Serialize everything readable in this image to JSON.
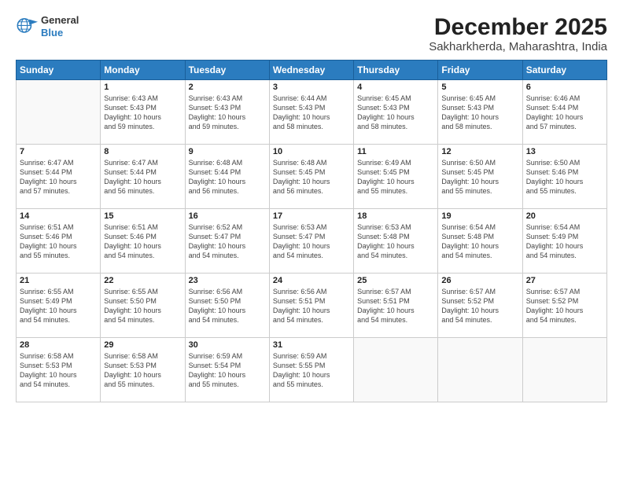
{
  "header": {
    "logo_general": "General",
    "logo_blue": "Blue",
    "month": "December 2025",
    "location": "Sakharkherda, Maharashtra, India"
  },
  "weekdays": [
    "Sunday",
    "Monday",
    "Tuesday",
    "Wednesday",
    "Thursday",
    "Friday",
    "Saturday"
  ],
  "weeks": [
    [
      {
        "day": "",
        "info": ""
      },
      {
        "day": "1",
        "info": "Sunrise: 6:43 AM\nSunset: 5:43 PM\nDaylight: 10 hours\nand 59 minutes."
      },
      {
        "day": "2",
        "info": "Sunrise: 6:43 AM\nSunset: 5:43 PM\nDaylight: 10 hours\nand 59 minutes."
      },
      {
        "day": "3",
        "info": "Sunrise: 6:44 AM\nSunset: 5:43 PM\nDaylight: 10 hours\nand 58 minutes."
      },
      {
        "day": "4",
        "info": "Sunrise: 6:45 AM\nSunset: 5:43 PM\nDaylight: 10 hours\nand 58 minutes."
      },
      {
        "day": "5",
        "info": "Sunrise: 6:45 AM\nSunset: 5:43 PM\nDaylight: 10 hours\nand 58 minutes."
      },
      {
        "day": "6",
        "info": "Sunrise: 6:46 AM\nSunset: 5:44 PM\nDaylight: 10 hours\nand 57 minutes."
      }
    ],
    [
      {
        "day": "7",
        "info": "Sunrise: 6:47 AM\nSunset: 5:44 PM\nDaylight: 10 hours\nand 57 minutes."
      },
      {
        "day": "8",
        "info": "Sunrise: 6:47 AM\nSunset: 5:44 PM\nDaylight: 10 hours\nand 56 minutes."
      },
      {
        "day": "9",
        "info": "Sunrise: 6:48 AM\nSunset: 5:44 PM\nDaylight: 10 hours\nand 56 minutes."
      },
      {
        "day": "10",
        "info": "Sunrise: 6:48 AM\nSunset: 5:45 PM\nDaylight: 10 hours\nand 56 minutes."
      },
      {
        "day": "11",
        "info": "Sunrise: 6:49 AM\nSunset: 5:45 PM\nDaylight: 10 hours\nand 55 minutes."
      },
      {
        "day": "12",
        "info": "Sunrise: 6:50 AM\nSunset: 5:45 PM\nDaylight: 10 hours\nand 55 minutes."
      },
      {
        "day": "13",
        "info": "Sunrise: 6:50 AM\nSunset: 5:46 PM\nDaylight: 10 hours\nand 55 minutes."
      }
    ],
    [
      {
        "day": "14",
        "info": "Sunrise: 6:51 AM\nSunset: 5:46 PM\nDaylight: 10 hours\nand 55 minutes."
      },
      {
        "day": "15",
        "info": "Sunrise: 6:51 AM\nSunset: 5:46 PM\nDaylight: 10 hours\nand 54 minutes."
      },
      {
        "day": "16",
        "info": "Sunrise: 6:52 AM\nSunset: 5:47 PM\nDaylight: 10 hours\nand 54 minutes."
      },
      {
        "day": "17",
        "info": "Sunrise: 6:53 AM\nSunset: 5:47 PM\nDaylight: 10 hours\nand 54 minutes."
      },
      {
        "day": "18",
        "info": "Sunrise: 6:53 AM\nSunset: 5:48 PM\nDaylight: 10 hours\nand 54 minutes."
      },
      {
        "day": "19",
        "info": "Sunrise: 6:54 AM\nSunset: 5:48 PM\nDaylight: 10 hours\nand 54 minutes."
      },
      {
        "day": "20",
        "info": "Sunrise: 6:54 AM\nSunset: 5:49 PM\nDaylight: 10 hours\nand 54 minutes."
      }
    ],
    [
      {
        "day": "21",
        "info": "Sunrise: 6:55 AM\nSunset: 5:49 PM\nDaylight: 10 hours\nand 54 minutes."
      },
      {
        "day": "22",
        "info": "Sunrise: 6:55 AM\nSunset: 5:50 PM\nDaylight: 10 hours\nand 54 minutes."
      },
      {
        "day": "23",
        "info": "Sunrise: 6:56 AM\nSunset: 5:50 PM\nDaylight: 10 hours\nand 54 minutes."
      },
      {
        "day": "24",
        "info": "Sunrise: 6:56 AM\nSunset: 5:51 PM\nDaylight: 10 hours\nand 54 minutes."
      },
      {
        "day": "25",
        "info": "Sunrise: 6:57 AM\nSunset: 5:51 PM\nDaylight: 10 hours\nand 54 minutes."
      },
      {
        "day": "26",
        "info": "Sunrise: 6:57 AM\nSunset: 5:52 PM\nDaylight: 10 hours\nand 54 minutes."
      },
      {
        "day": "27",
        "info": "Sunrise: 6:57 AM\nSunset: 5:52 PM\nDaylight: 10 hours\nand 54 minutes."
      }
    ],
    [
      {
        "day": "28",
        "info": "Sunrise: 6:58 AM\nSunset: 5:53 PM\nDaylight: 10 hours\nand 54 minutes."
      },
      {
        "day": "29",
        "info": "Sunrise: 6:58 AM\nSunset: 5:53 PM\nDaylight: 10 hours\nand 55 minutes."
      },
      {
        "day": "30",
        "info": "Sunrise: 6:59 AM\nSunset: 5:54 PM\nDaylight: 10 hours\nand 55 minutes."
      },
      {
        "day": "31",
        "info": "Sunrise: 6:59 AM\nSunset: 5:55 PM\nDaylight: 10 hours\nand 55 minutes."
      },
      {
        "day": "",
        "info": ""
      },
      {
        "day": "",
        "info": ""
      },
      {
        "day": "",
        "info": ""
      }
    ]
  ]
}
